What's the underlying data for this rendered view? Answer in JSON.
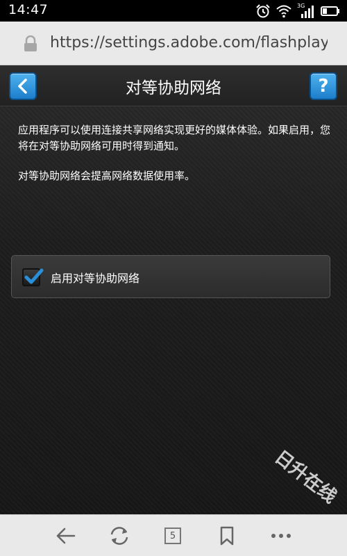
{
  "status_bar": {
    "time": "14:47",
    "network": "3G",
    "icons": [
      "alarm-icon",
      "wifi-icon",
      "signal-icon",
      "battery-icon"
    ]
  },
  "browser": {
    "url": "https://settings.adobe.com/flashplaye..",
    "tabs_count": "5",
    "toolbar_icons": [
      "back-arrow-icon",
      "reload-icon",
      "tabs-icon",
      "bookmark-icon",
      "more-icon"
    ]
  },
  "page": {
    "title": "对等协助网络",
    "help_label": "?",
    "description": "应用程序可以使用连接共享网络实现更好的媒体体验。如果启用，您将在对等协助网络可用时得到通知。",
    "note": "对等协助网络会提高网络数据使用率。",
    "option": {
      "label": "启用对等协助网络",
      "checked": true
    }
  },
  "watermark": "日升在线",
  "colors": {
    "accent_blue": "#2a8fd8",
    "background": "#1d1d1d",
    "toolbar": "#e9e9e9"
  }
}
